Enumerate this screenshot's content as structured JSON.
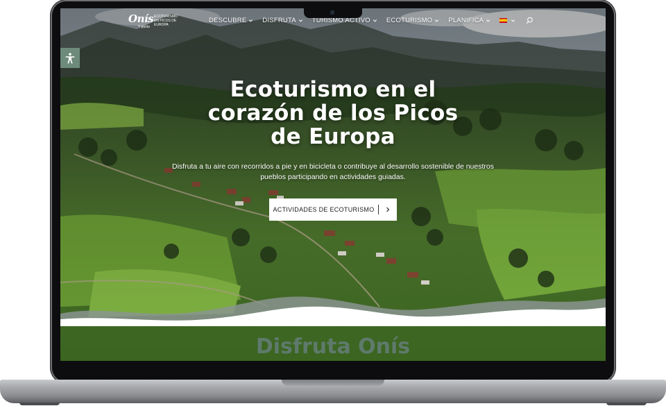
{
  "logo": {
    "wordmark": "Onís",
    "subline": "Y punto",
    "tagline": "ECOTURISMO EN PICOS DE EUROPA"
  },
  "nav": {
    "items": [
      {
        "label": "DESCUBRE",
        "dropdown": true
      },
      {
        "label": "DISFRUTA",
        "dropdown": true
      },
      {
        "label": "TURISMO ACTIVO",
        "dropdown": true
      },
      {
        "label": "ECOTURISMO",
        "dropdown": true
      },
      {
        "label": "PLANIFICA",
        "dropdown": true
      }
    ],
    "language_icon": "spain-flag-icon",
    "search_icon": "search-icon"
  },
  "accessibility_icon": "accessibility-person-icon",
  "hero": {
    "title_lines": [
      "Ecoturismo en el",
      "corazón de los Picos",
      "de Europa"
    ],
    "subtitle": "Disfruta a tu aire con recorridos a pie y en bicicleta o contribuye al desarrollo sostenible de nuestros pueblos participando en actividades guiadas.",
    "cta_label": "ACTIVIDADES DE ECOTURISMO"
  },
  "section": {
    "title": "Disfruta Onís"
  },
  "colors": {
    "accent_green": "#5f7a6c",
    "accessibility_bg": "#6e8a7b",
    "wave_gray": "#7f8a84",
    "laptop_bezel": "#0d0d0f"
  }
}
